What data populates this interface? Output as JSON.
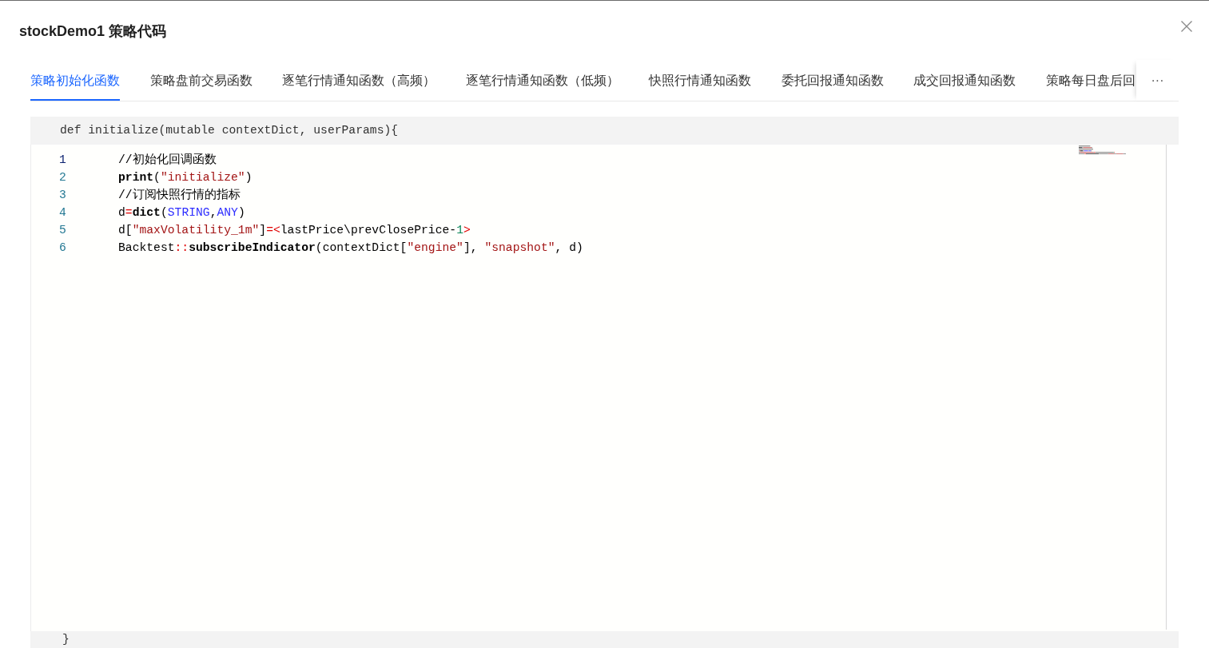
{
  "dialog": {
    "title": "stockDemo1 策略代码"
  },
  "tabs": [
    {
      "label": "策略初始化函数",
      "selected": true
    },
    {
      "label": "策略盘前交易函数",
      "selected": false
    },
    {
      "label": "逐笔行情通知函数（高频）",
      "selected": false
    },
    {
      "label": "逐笔行情通知函数（低频）",
      "selected": false
    },
    {
      "label": "快照行情通知函数",
      "selected": false
    },
    {
      "label": "委托回报通知函数",
      "selected": false
    },
    {
      "label": "成交回报通知函数",
      "selected": false
    },
    {
      "label": "策略每日盘后回",
      "selected": false
    }
  ],
  "more_tabs": {
    "label": "···"
  },
  "editor": {
    "header": "def initialize(mutable contextDict, userParams){",
    "lines": [
      {
        "number": "1",
        "current": true,
        "tokens": [
          {
            "kind": "plain",
            "text": "//初始化回调函数"
          }
        ]
      },
      {
        "number": "2",
        "current": false,
        "tokens": [
          {
            "kind": "keyword",
            "text": "print"
          },
          {
            "kind": "plain",
            "text": "("
          },
          {
            "kind": "string",
            "text": "\"initialize\""
          },
          {
            "kind": "plain",
            "text": ")"
          }
        ]
      },
      {
        "number": "3",
        "current": false,
        "tokens": [
          {
            "kind": "plain",
            "text": "//订阅快照行情的指标"
          }
        ]
      },
      {
        "number": "4",
        "current": false,
        "tokens": [
          {
            "kind": "plain",
            "text": "d"
          },
          {
            "kind": "operator",
            "text": "="
          },
          {
            "kind": "keyword",
            "text": "dict"
          },
          {
            "kind": "plain",
            "text": "("
          },
          {
            "kind": "constant",
            "text": "STRING"
          },
          {
            "kind": "plain",
            "text": ","
          },
          {
            "kind": "constant",
            "text": "ANY"
          },
          {
            "kind": "plain",
            "text": ")"
          }
        ]
      },
      {
        "number": "5",
        "current": false,
        "tokens": [
          {
            "kind": "plain",
            "text": "d["
          },
          {
            "kind": "string",
            "text": "\"maxVolatility_1m\""
          },
          {
            "kind": "plain",
            "text": "]"
          },
          {
            "kind": "operator",
            "text": "=<"
          },
          {
            "kind": "plain",
            "text": "lastPrice\\prevClosePrice-"
          },
          {
            "kind": "number",
            "text": "1"
          },
          {
            "kind": "operator",
            "text": ">"
          }
        ]
      },
      {
        "number": "6",
        "current": false,
        "tokens": [
          {
            "kind": "plain",
            "text": "Backtest"
          },
          {
            "kind": "operator",
            "text": "::"
          },
          {
            "kind": "keyword",
            "text": "subscribeIndicator"
          },
          {
            "kind": "plain",
            "text": "(contextDict["
          },
          {
            "kind": "string",
            "text": "\"engine\""
          },
          {
            "kind": "plain",
            "text": "], "
          },
          {
            "kind": "string",
            "text": "\"snapshot\""
          },
          {
            "kind": "plain",
            "text": ", d)"
          }
        ]
      }
    ],
    "footer": "}"
  }
}
